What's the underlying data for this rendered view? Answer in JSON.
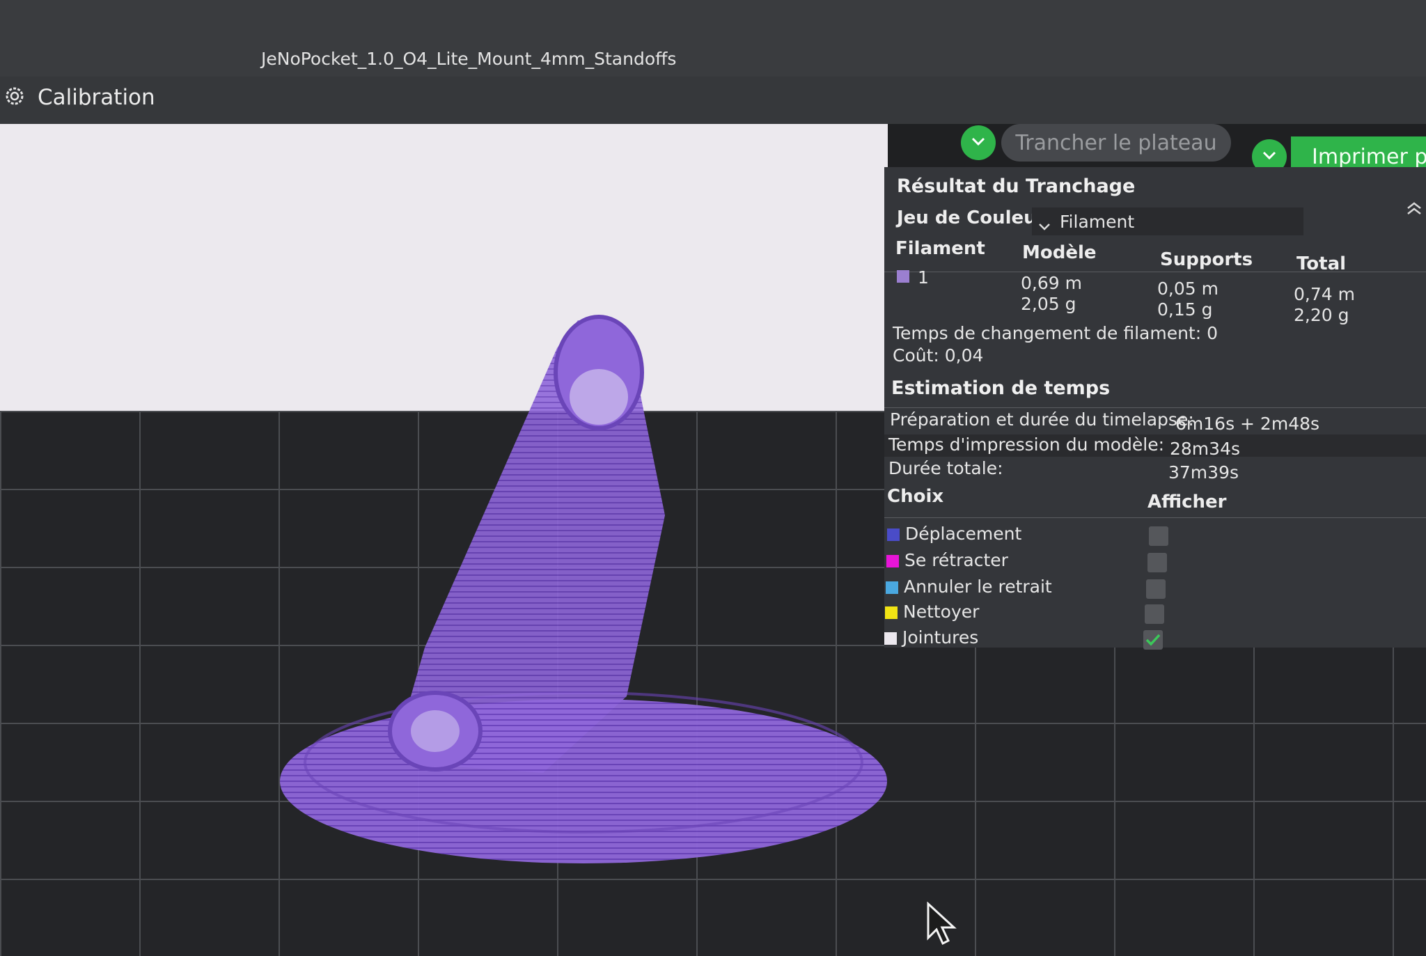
{
  "window": {
    "title": "JeNoPocket_1.0_O4_Lite_Mount_4mm_Standoffs"
  },
  "menu": {
    "calibration_label": "Calibration",
    "icon": "gear-icon"
  },
  "toolbar": {
    "slice_label": "Trancher le plateau",
    "print_label": "Imprimer plat",
    "accent_color": "#2fb44a"
  },
  "slicing": {
    "title": "Résultat du Tranchage",
    "color_set_label": "Jeu de Couleur",
    "color_set_value": "Filament",
    "columns": [
      "Filament",
      "Modèle",
      "Supports",
      "Total"
    ],
    "filament_row": {
      "id": "1",
      "swatch_color": "#9b7fd0",
      "model_length": "0,69 m",
      "model_weight": "2,05 g",
      "supports_length": "0,05 m",
      "supports_weight": "0,15 g",
      "total_length": "0,74 m",
      "total_weight": "2,20 g"
    },
    "change_time": "Temps de changement de filament: 0",
    "cost": "Coût: 0,04"
  },
  "time_estimate": {
    "title": "Estimation de temps",
    "prep_label": "Préparation et durée du timelapse:",
    "prep_value": "6m16s + 2m48s",
    "model_label": "Temps d'impression du modèle:",
    "model_value": "28m34s",
    "total_label": "Durée totale:",
    "total_value": "37m39s"
  },
  "options": {
    "choice_header": "Choix",
    "show_header": "Afficher",
    "items": [
      {
        "label": "Déplacement",
        "color": "#4a4cc8",
        "checked": false
      },
      {
        "label": "Se rétracter",
        "color": "#e815d8",
        "checked": false
      },
      {
        "label": "Annuler le retrait",
        "color": "#4aa8e0",
        "checked": false
      },
      {
        "label": "Nettoyer",
        "color": "#f2e414",
        "checked": false
      },
      {
        "label": "Jointures",
        "color": "#ece8ee",
        "checked": true
      }
    ]
  }
}
